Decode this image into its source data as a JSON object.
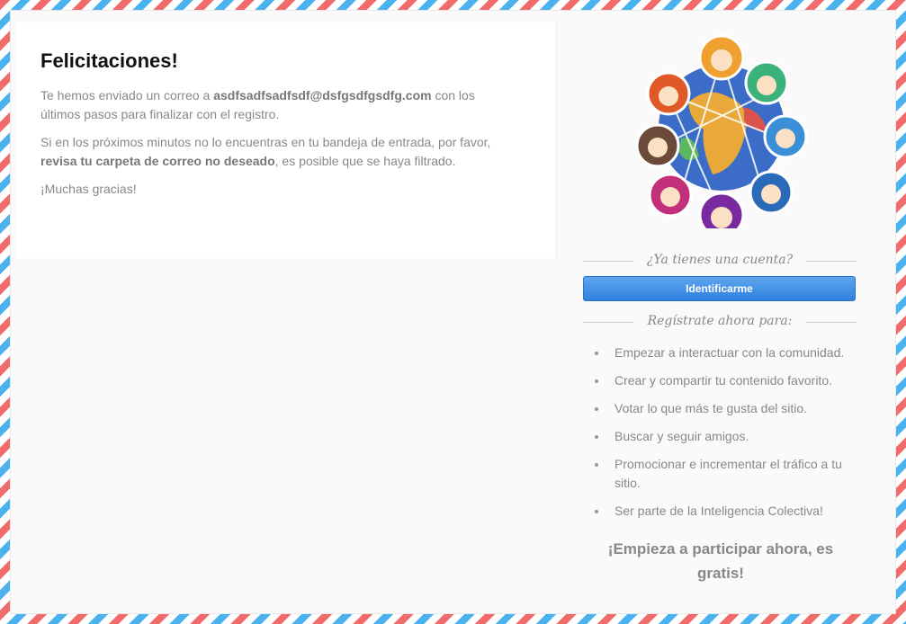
{
  "left": {
    "title": "Felicitaciones!",
    "p1_a": "Te hemos enviado un correo a ",
    "p1_email": "asdfsadfsadfsdf@dsfgsdfgsdfg.com",
    "p1_b": " con los últimos pasos para finalizar con el registro.",
    "p2_a": "Si en los próximos minutos no lo encuentras en tu bandeja de entrada, por favor, ",
    "p2_bold": "revisa tu carpeta de correo no deseado",
    "p2_b": ", es posible que se haya filtrado.",
    "p3": "¡Muchas gracias!"
  },
  "right": {
    "account_question": "¿Ya tienes una cuenta?",
    "login_button": "Identificarme",
    "register_heading": "Regístrate ahora para:",
    "benefits": [
      "Empezar a interactuar con la comunidad.",
      "Crear y compartir tu contenido favorito.",
      "Votar lo que más te gusta del sitio.",
      "Buscar y seguir amigos.",
      "Promocionar e incrementar el tráfico a tu sitio.",
      "Ser parte de la Inteligencia Colectiva!"
    ],
    "cta": "¡Empieza a participar ahora, es gratis!"
  },
  "colors": {
    "stripe_red": "#f26b6b",
    "stripe_blue": "#4ab3ef",
    "button_blue": "#2f80df"
  },
  "icons": [
    "community-globe-illustration",
    "bullet-dot-icon"
  ]
}
